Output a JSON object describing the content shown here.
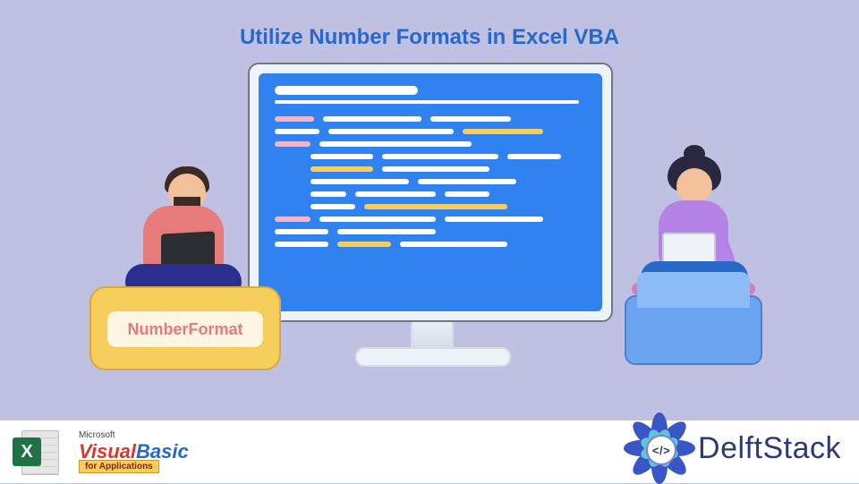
{
  "title": "Utilize Number Formats in Excel VBA",
  "cushion_label": "NumberFormat",
  "bottom": {
    "excel_letter": "X",
    "vb_microsoft": "Microsoft",
    "vb_visual": "Visual",
    "vb_basic": "Basic",
    "vb_for_apps": "for Applications",
    "delft_code": "</>",
    "delft_name": "DelftStack"
  }
}
